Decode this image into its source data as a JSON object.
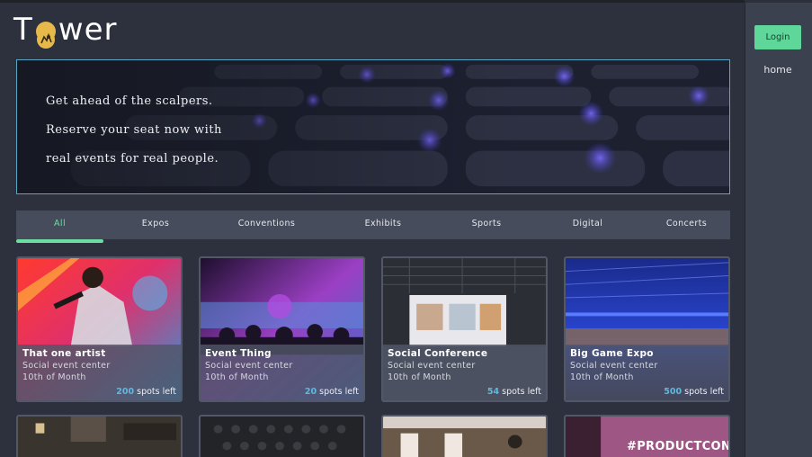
{
  "app": {
    "logo_before": "T",
    "logo_after": "wer"
  },
  "sidebar": {
    "login_label": "Login",
    "home_label": "home"
  },
  "hero": {
    "lines": [
      "Get ahead of the scalpers.",
      "Reserve your seat now with",
      "real events for real people."
    ]
  },
  "tabs": [
    {
      "label": "All",
      "active": true
    },
    {
      "label": "Expos",
      "active": false
    },
    {
      "label": "Conventions",
      "active": false
    },
    {
      "label": "Exhibits",
      "active": false
    },
    {
      "label": "Sports",
      "active": false
    },
    {
      "label": "Digital",
      "active": false
    },
    {
      "label": "Concerts",
      "active": false
    }
  ],
  "events": [
    {
      "name": "That one artist",
      "venue": "Social event center",
      "date": "10th of Month",
      "spots": "200",
      "spots_suffix": " spots left"
    },
    {
      "name": "Event Thing",
      "venue": "Social event center",
      "date": "10th of Month",
      "spots": "20",
      "spots_suffix": " spots left"
    },
    {
      "name": "Social Conference",
      "venue": "Social event center",
      "date": "10th of Month",
      "spots": "54",
      "spots_suffix": " spots left"
    },
    {
      "name": "Big Game Expo",
      "venue": "Social event center",
      "date": "10th of Month",
      "spots": "500",
      "spots_suffix": " spots left"
    }
  ],
  "partial_card_text": "#PRODUCTCON",
  "colors": {
    "accent": "#6fdca3",
    "spots_number": "#5fb8de",
    "hero_border": "#5aa7c4"
  }
}
